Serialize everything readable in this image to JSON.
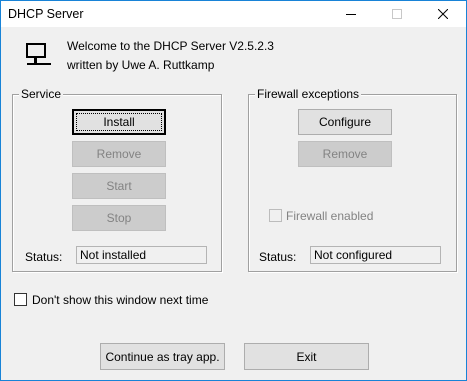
{
  "window": {
    "title": "DHCP Server"
  },
  "header": {
    "welcome": "Welcome to the DHCP Server V2.5.2.3",
    "author": "written by Uwe A. Ruttkamp"
  },
  "service": {
    "legend": "Service",
    "install": "Install",
    "remove": "Remove",
    "start": "Start",
    "stop": "Stop",
    "status_label": "Status:",
    "status_value": "Not installed"
  },
  "firewall": {
    "legend": "Firewall exceptions",
    "configure": "Configure",
    "remove": "Remove",
    "enabled_label": "Firewall enabled",
    "enabled_checked": false,
    "status_label": "Status:",
    "status_value": "Not configured"
  },
  "options": {
    "dont_show_label": "Don't show this window next time",
    "dont_show_checked": false
  },
  "footer": {
    "tray": "Continue as tray app.",
    "exit": "Exit"
  },
  "colors": {
    "window_border": "#1883d7",
    "dialog_bg": "#f0f0f0",
    "disabled_text": "#838383"
  }
}
